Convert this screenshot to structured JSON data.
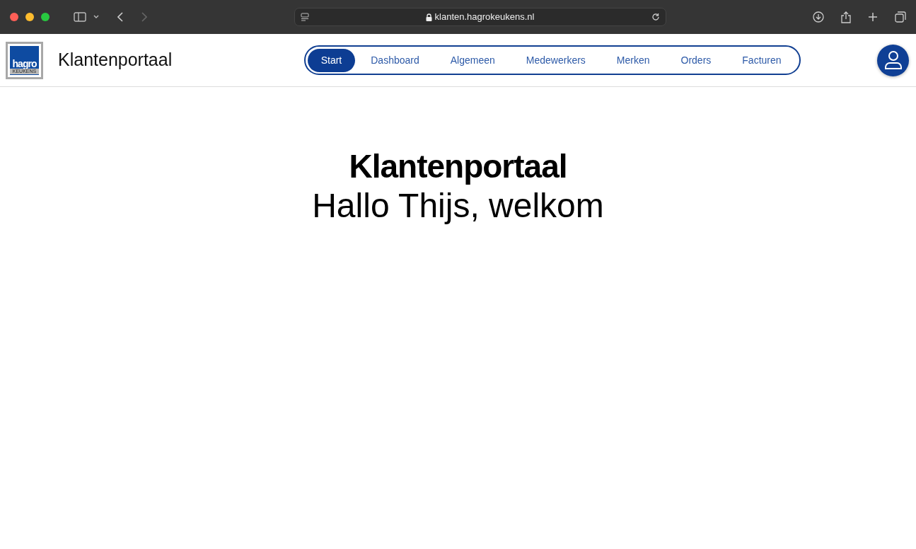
{
  "browser": {
    "url": "klanten.hagrokeukens.nl"
  },
  "header": {
    "logo": {
      "name": "hagro",
      "sub": "KEUKENS"
    },
    "title": "Klantenportaal",
    "nav": [
      {
        "label": "Start",
        "selected": true
      },
      {
        "label": "Dashboard",
        "selected": false
      },
      {
        "label": "Algemeen",
        "selected": false
      },
      {
        "label": "Medewerkers",
        "selected": false
      },
      {
        "label": "Merken",
        "selected": false
      },
      {
        "label": "Orders",
        "selected": false
      },
      {
        "label": "Facturen",
        "selected": false
      }
    ]
  },
  "main": {
    "heading": "Klantenportaal",
    "greeting": "Hallo Thijs, welkom"
  }
}
